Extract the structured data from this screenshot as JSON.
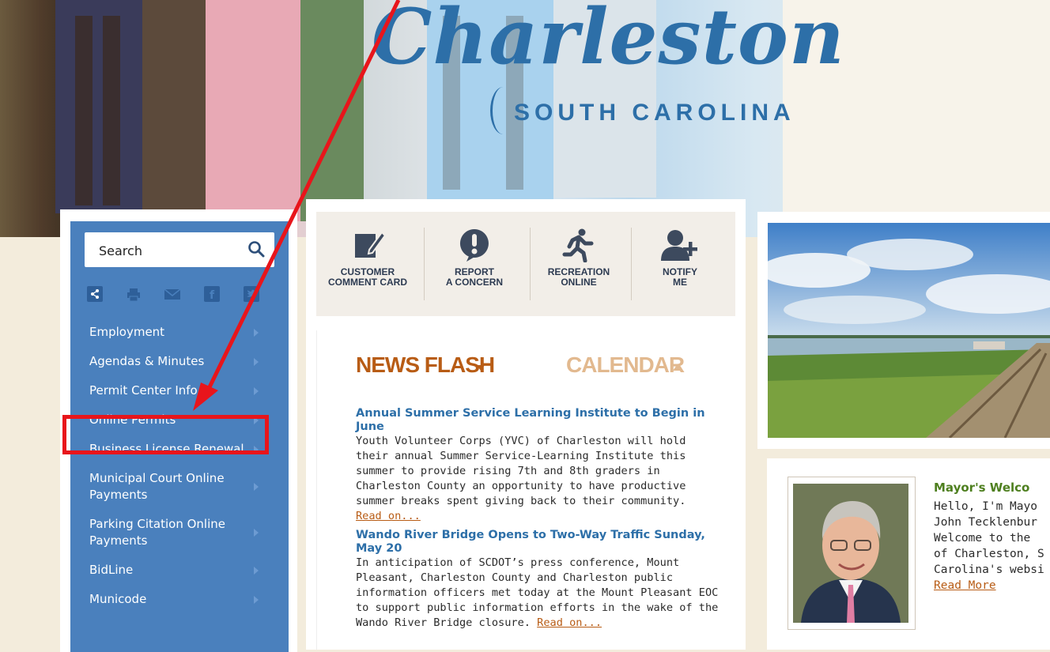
{
  "header": {
    "brand": "Charleston",
    "tagline": "SOUTH CAROLINA"
  },
  "sidebar": {
    "search_label": "Search",
    "share_icons": [
      "share-icon",
      "print-icon",
      "email-icon",
      "facebook-icon",
      "twitter-icon"
    ],
    "items": [
      {
        "label": "Employment"
      },
      {
        "label": "Agendas & Minutes"
      },
      {
        "label": "Permit Center Info"
      },
      {
        "label": "Online Permits"
      },
      {
        "label": "Business License Renewal"
      },
      {
        "label": "Municipal Court Online Payments"
      },
      {
        "label": "Parking Citation Online Payments"
      },
      {
        "label": "BidLine"
      },
      {
        "label": "Municode"
      }
    ]
  },
  "quick_links": [
    {
      "label": "CUSTOMER\nCOMMENT CARD",
      "icon": "comment-card-icon"
    },
    {
      "label": "REPORT\nA CONCERN",
      "icon": "concern-icon"
    },
    {
      "label": "RECREATION\nONLINE",
      "icon": "recreation-icon"
    },
    {
      "label": "NOTIFY\nME",
      "icon": "notify-icon"
    }
  ],
  "news": {
    "tab_news": "NEWS FLASH",
    "tab_calendar": "CALENDAR",
    "articles": [
      {
        "title": "Annual Summer Service Learning Institute to Begin in June",
        "body": "Youth Volunteer Corps (YVC) of Charleston will hold their annual Summer Service-Learning Institute this summer to provide rising 7th and 8th graders in Charleston County an opportunity to have productive summer breaks spent giving back to their community.",
        "more": "Read on..."
      },
      {
        "title": "Wando River Bridge Opens to Two-Way Traffic Sunday, May 20",
        "body": "In anticipation of SCDOT’s press conference, Mount Pleasant, Charleston County and Charleston public information officers met today at the Mount Pleasant EOC to support public information efforts in the wake of the Wando River Bridge closure.",
        "more": "Read on..."
      }
    ]
  },
  "mayor": {
    "title": "Mayor's Welco",
    "lines": [
      "Hello, I'm Mayo",
      "John Tecklenbur",
      "Welcome to the",
      "of Charleston, S",
      "Carolina's websi"
    ],
    "more": "Read More"
  },
  "colors": {
    "sidebar_bg": "#4a80bd",
    "brand_blue": "#2d6fa8",
    "news_orange": "#b85c15",
    "calendar_tan": "#e2b98f",
    "mayor_green": "#4e7f1f",
    "annotation_red": "#e8151b"
  }
}
